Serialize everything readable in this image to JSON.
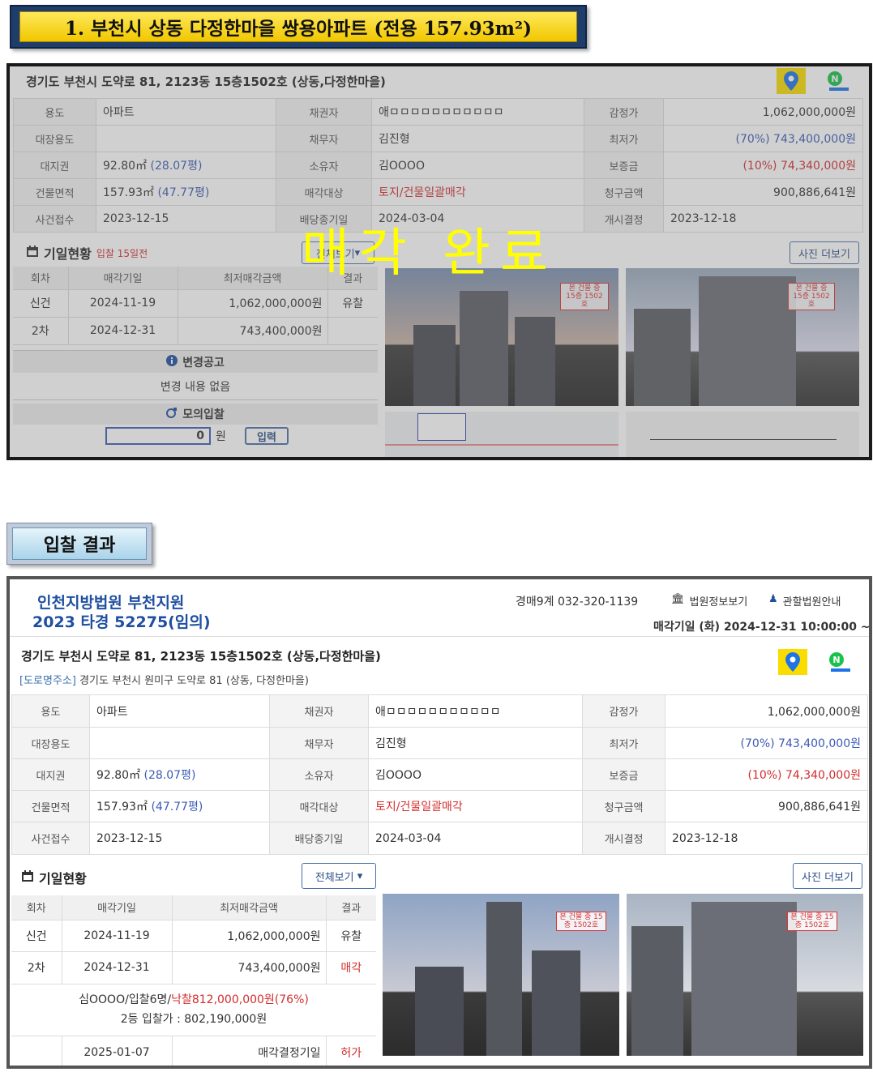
{
  "title_banner": "1. 부천시 상동 다정한마을 쌍용아파트 (전용 157.93m²)",
  "subtitle_banner": "입찰 결과",
  "sold_overlay": "매각 완료",
  "panel1": {
    "address": "경기도 부천시 도약로 81, 2123동 15층1502호 (상동,다정한마을)",
    "rows": [
      {
        "l1": "용도",
        "v1": "아파트",
        "l2": "채권자",
        "v2": "애ㅁㅁㅁㅁㅁㅁㅁㅁㅁㅁㅁ",
        "l3": "감정가",
        "v3": "1,062,000,000원"
      },
      {
        "l1": "대장용도",
        "v1": "",
        "l2": "채무자",
        "v2": "김진형",
        "l3": "최저가",
        "v3a": "(70%)",
        "v3b": "743,400,000원"
      },
      {
        "l1": "대지권",
        "v1a": "92.80㎡",
        "v1b": "(28.07평)",
        "l2": "소유자",
        "v2": "김OOOO",
        "l3": "보증금",
        "v3a": "(10%)",
        "v3b": "74,340,000원"
      },
      {
        "l1": "건물면적",
        "v1a": "157.93㎡",
        "v1b": "(47.77평)",
        "l2": "매각대상",
        "v2": "토지/건물일괄매각",
        "l3": "청구금액",
        "v3": "900,886,641원"
      },
      {
        "l1": "사건접수",
        "v1": "2023-12-15",
        "l2": "배당종기일",
        "v2": "2024-03-04",
        "l3": "개시결정",
        "v3": "2023-12-18"
      }
    ],
    "schedule_title": "기일현황",
    "schedule_note": "입찰 15일전",
    "view_all_label": "전체보기",
    "photo_more_label": "사진 더보기",
    "sched_headers": [
      "회차",
      "매각기일",
      "최저매각금액",
      "결과"
    ],
    "sched_rows": [
      {
        "round": "신건",
        "date": "2024-11-19",
        "price": "1,062,000,000원",
        "result": "유찰"
      },
      {
        "round": "2차",
        "date": "2024-12-31",
        "price": "743,400,000원",
        "result": ""
      }
    ],
    "change_notice_title": "변경공고",
    "change_notice_body": "변경 내용 없음",
    "mock_bid_title": "모의입찰",
    "mock_bid_value": "0",
    "mock_bid_unit": "원",
    "mock_bid_button": "입력",
    "photo_label_1": "본 건물 중 15층 1502호",
    "photo_label_2": "본 건물 중 15층 1502호"
  },
  "panel2": {
    "court": "인천지방법원 부천지원",
    "case_no": "2023 타경 52275(임의)",
    "division_phone": "경매9계 032-320-1139",
    "court_info_label": "법원정보보기",
    "jurisdiction_label": "관할법원안내",
    "sale_date_line": "매각기일 (화) 2024-12-31 10:00:00 ~",
    "address": "경기도 부천시 도약로 81, 2123동 15층1502호 (상동,다정한마을)",
    "road_tag": "[도로명주소]",
    "road_address": "경기도 부천시 원미구 도약로 81 (상동, 다정한마을)",
    "rows": [
      {
        "l1": "용도",
        "v1": "아파트",
        "l2": "채권자",
        "v2": "애ㅁㅁㅁㅁㅁㅁㅁㅁㅁㅁㅁ",
        "l3": "감정가",
        "v3": "1,062,000,000원"
      },
      {
        "l1": "대장용도",
        "v1": "",
        "l2": "채무자",
        "v2": "김진형",
        "l3": "최저가",
        "v3a": "(70%)",
        "v3b": "743,400,000원"
      },
      {
        "l1": "대지권",
        "v1a": "92.80㎡",
        "v1b": "(28.07평)",
        "l2": "소유자",
        "v2": "김OOOO",
        "l3": "보증금",
        "v3a": "(10%)",
        "v3b": "74,340,000원"
      },
      {
        "l1": "건물면적",
        "v1a": "157.93㎡",
        "v1b": "(47.77평)",
        "l2": "매각대상",
        "v2": "토지/건물일괄매각",
        "l3": "청구금액",
        "v3": "900,886,641원"
      },
      {
        "l1": "사건접수",
        "v1": "2023-12-15",
        "l2": "배당종기일",
        "v2": "2024-03-04",
        "l3": "개시결정",
        "v3": "2023-12-18"
      }
    ],
    "schedule_title": "기일현황",
    "view_all_label": "전체보기",
    "photo_more_label": "사진 더보기",
    "sched_headers": [
      "회차",
      "매각기일",
      "최저매각금액",
      "결과"
    ],
    "sched_rows": [
      {
        "round": "신건",
        "date": "2024-11-19",
        "price": "1,062,000,000원",
        "result": "유찰"
      },
      {
        "round": "2차",
        "date": "2024-12-31",
        "price": "743,400,000원",
        "result": "매각"
      }
    ],
    "winner_prefix": "심OOOO/입찰6명/",
    "winner_price": "낙찰812,000,000원(76%)",
    "second_bid": "2등 입찰가 : 802,190,000원",
    "decision_date": "2025-01-07",
    "decision_label": "매각결정기일",
    "decision_result": "허가",
    "photo_label_1": "본 건물 중 15층 1502호",
    "photo_label_2": "본 건물 중 15층 1502호"
  }
}
